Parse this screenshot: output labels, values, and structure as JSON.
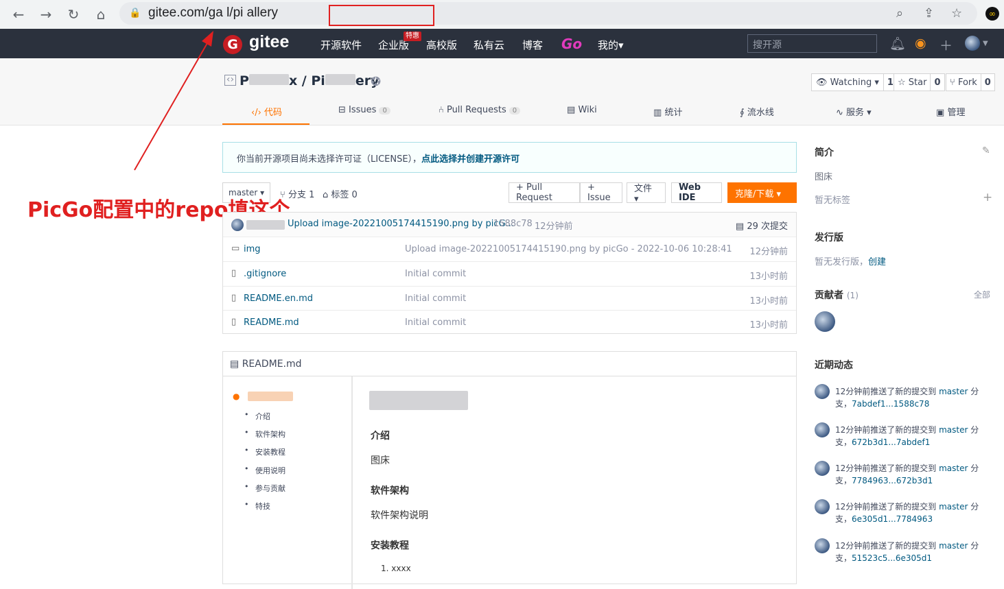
{
  "browser": {
    "url": "gitee.com/ga   l/pi   allery",
    "back": "←",
    "forward": "→",
    "reload": "↻",
    "home": "⌂"
  },
  "header": {
    "logo": "gitee",
    "nav": [
      "开源软件",
      "企业版",
      "高校版",
      "私有云",
      "博客",
      "Go",
      "我的▾"
    ],
    "badge": "特惠",
    "search_placeholder": "搜开源"
  },
  "repo": {
    "title_left": "P",
    "title_mid": "x / Pi",
    "title_right": "ery",
    "watching": "Watching ▾",
    "watching_count": "1",
    "star": "Star",
    "star_count": "0",
    "fork": "Fork",
    "fork_count": "0",
    "tabs": [
      {
        "label": "代码"
      },
      {
        "label": "Issues",
        "count": "0"
      },
      {
        "label": "Pull Requests",
        "count": "0"
      },
      {
        "label": "Wiki"
      },
      {
        "label": "统计"
      },
      {
        "label": "流水线"
      },
      {
        "label": "服务 ▾"
      },
      {
        "label": "管理"
      }
    ]
  },
  "license": {
    "text": "你当前开源项目尚未选择许可证（LICENSE），",
    "link": "点此选择并创建开源许可"
  },
  "branchbar": {
    "branch": "master ▾",
    "branches": "分支 1",
    "tags": "标签 0",
    "pull_request": "+ Pull Request",
    "issue": "+ Issue",
    "files": "文件 ▾",
    "web_ide": "Web IDE",
    "clone": "克隆/下载 ▾"
  },
  "latest_commit": {
    "message": "Upload image-20221005174415190.png by picG...",
    "hash": "1588c78",
    "time": "12分钟前",
    "commits": "29 次提交"
  },
  "files": [
    {
      "name": "img",
      "type": "folder",
      "msg": "Upload image-20221005174415190.png by picGo - 2022-10-06 10:28:41",
      "time": "12分钟前"
    },
    {
      "name": ".gitignore",
      "type": "file",
      "msg": "Initial commit",
      "time": "13小时前"
    },
    {
      "name": "README.en.md",
      "type": "file",
      "msg": "Initial commit",
      "time": "13小时前"
    },
    {
      "name": "README.md",
      "type": "file",
      "msg": "Initial commit",
      "time": "13小时前"
    }
  ],
  "readme": {
    "header": "README.md",
    "toc": [
      "介绍",
      "软件架构",
      "安装教程",
      "使用说明",
      "参与贡献",
      "特技"
    ],
    "h_intro": "介绍",
    "p_intro": "图床",
    "h_arch": "软件架构",
    "p_arch": "软件架构说明",
    "h_install": "安装教程",
    "li1": "1. xxxx"
  },
  "sidebar": {
    "intro_title": "简介",
    "intro_text": "图床",
    "no_tags": "暂无标签",
    "release_title": "发行版",
    "no_release": "暂无发行版，",
    "create": "创建",
    "contrib_title": "贡献者",
    "contrib_count": "(1)",
    "all": "全部",
    "activity_title": "近期动态",
    "activities": [
      {
        "text": "12分钟前推送了新的提交到",
        "branch": "master",
        "range": "7abdef1...1588c78"
      },
      {
        "text": "12分钟前推送了新的提交到",
        "branch": "master",
        "range": "672b3d1...7abdef1"
      },
      {
        "text": "12分钟前推送了新的提交到",
        "branch": "master",
        "range": "7784963...672b3d1"
      },
      {
        "text": "12分钟前推送了新的提交到",
        "branch": "master",
        "range": "6e305d1...7784963"
      },
      {
        "text": "12分钟前推送了新的提交到",
        "branch": "master",
        "range": "51523c5...6e305d1"
      }
    ],
    "branch_suffix": " 分",
    "branch_suffix2": "支，"
  },
  "annotation": "PicGo配置中的repo填这个",
  "colors": {
    "accent": "#fe7300",
    "annotation": "#e02020",
    "header": "#2b313d",
    "link": "#005980"
  }
}
